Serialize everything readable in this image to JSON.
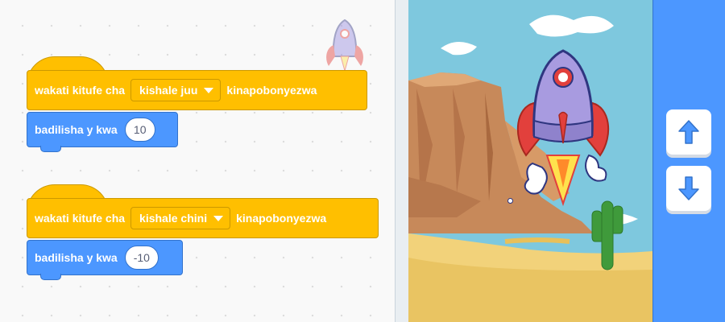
{
  "scripts": [
    {
      "hat_text_before": "wakati kitufe cha",
      "key_option": "kishale juu",
      "hat_text_after": "kinapobonyezwa",
      "motion_label": "badilisha y kwa",
      "motion_value": "10"
    },
    {
      "hat_text_before": "wakati kitufe cha",
      "key_option": "kishale chini",
      "hat_text_after": "kinapobonyezwa",
      "motion_label": "badilisha y kwa",
      "motion_value": "-10"
    }
  ],
  "controls": {
    "up_icon": "arrow-up-icon",
    "down_icon": "arrow-down-icon"
  },
  "colors": {
    "events": "#ffbf00",
    "motion": "#4c97ff",
    "control_panel": "#4c97ff",
    "sky": "#7ec8de",
    "sand": "#f2d27a"
  }
}
